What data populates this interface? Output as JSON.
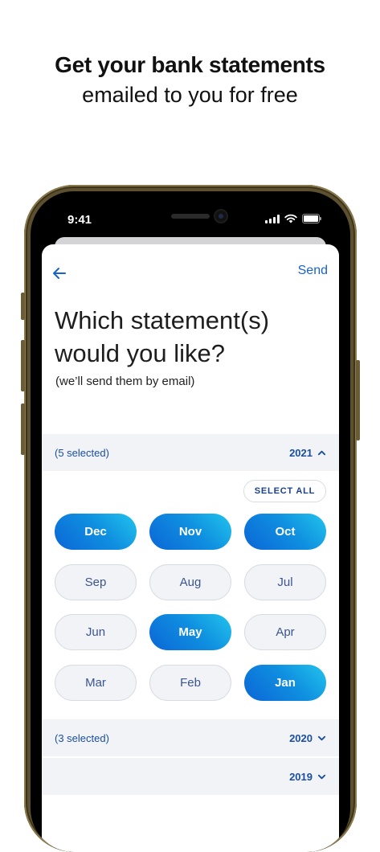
{
  "marketing": {
    "headline_line1": "Get your bank statements",
    "headline_line2": "emailed to you for free"
  },
  "status_bar": {
    "time": "9:41"
  },
  "nav": {
    "send_label": "Send"
  },
  "page": {
    "title_line1": "Which statement(s)",
    "title_line2": "would you like?",
    "subtitle": "(we’ll send them by email)"
  },
  "years": [
    {
      "selected_text": "(5 selected)",
      "year": "2021",
      "expanded": true
    },
    {
      "selected_text": "(3 selected)",
      "year": "2020",
      "expanded": false
    },
    {
      "selected_text": "",
      "year": "2019",
      "expanded": false
    }
  ],
  "select_all_label": "SELECT ALL",
  "months_2021": [
    {
      "label": "Dec",
      "selected": true
    },
    {
      "label": "Nov",
      "selected": true
    },
    {
      "label": "Oct",
      "selected": true
    },
    {
      "label": "Sep",
      "selected": false
    },
    {
      "label": "Aug",
      "selected": false
    },
    {
      "label": "Jul",
      "selected": false
    },
    {
      "label": "Jun",
      "selected": false
    },
    {
      "label": "May",
      "selected": true
    },
    {
      "label": "Apr",
      "selected": false
    },
    {
      "label": "Mar",
      "selected": false
    },
    {
      "label": "Feb",
      "selected": false
    },
    {
      "label": "Jan",
      "selected": true
    }
  ],
  "colors": {
    "accent": "#1a63c6",
    "selected_gradient_start": "#0b66d6",
    "selected_gradient_end": "#22c4ec",
    "section_bg": "#f2f3f7"
  }
}
